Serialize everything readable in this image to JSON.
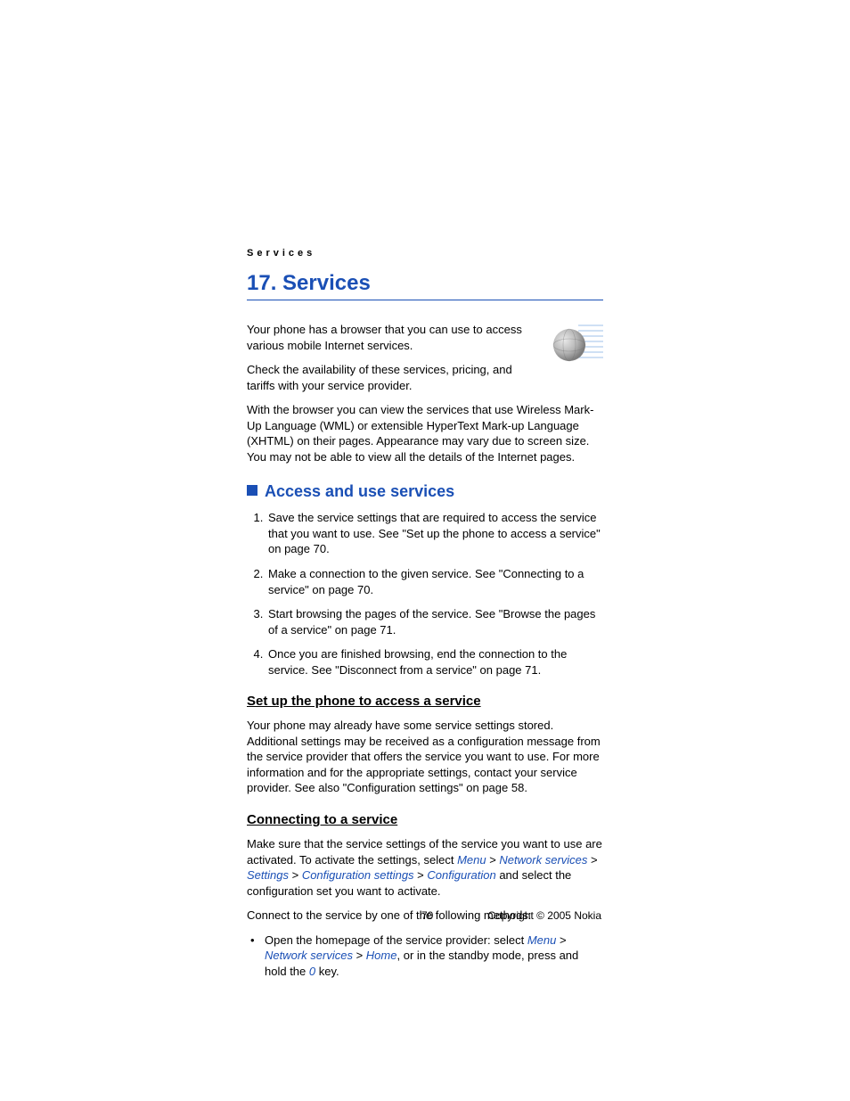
{
  "running_header": "Services",
  "chapter": {
    "number": "17.",
    "title": "Services"
  },
  "intro1": "Your phone has a browser that you can use to access various mobile Internet services.",
  "intro2": "Check the availability of these services, pricing, and tariffs with your service provider.",
  "intro3": "With the browser you can view the services that use Wireless Mark-Up Language (WML) or extensible HyperText Mark-up Language (XHTML) on their pages. Appearance may vary due to screen size. You may not be able to view all the details of the Internet pages.",
  "section1": {
    "title": "Access and use services",
    "items": [
      "Save the service settings that are required to access the service that you want to use. See \"Set up the phone to access a service\" on page 70.",
      "Make a connection to the given service. See \"Connecting to a service\" on page 70.",
      "Start browsing the pages of the service. See \"Browse the pages of a service\" on page 71.",
      "Once you are finished browsing, end the connection to the service. See \"Disconnect from a service\" on page 71."
    ]
  },
  "sub1": {
    "title": "Set up the phone to access a service",
    "body": "Your phone may already have some service settings stored. Additional settings may be received as a configuration message from the service provider that offers the service you want to use. For more information and for the appropriate settings, contact your service provider. See also \"Configuration settings\" on page 58."
  },
  "sub2": {
    "title": "Connecting to a service",
    "lead_prefix": "Make sure that the service settings of the service you want to use are activated. To activate the settings, select ",
    "path": {
      "menu": "Menu",
      "netserv": "Network services",
      "settings": "Settings",
      "confset": "Configuration settings",
      "conf": "Configuration"
    },
    "lead_suffix": " and select the configuration set you want to activate.",
    "methods_intro": "Connect to the service by one of the following methods:",
    "bullet1_prefix": "Open the homepage of the service provider: select ",
    "home": "Home",
    "bullet1_mid": ", or in the standby mode, press and hold the ",
    "zero": "0",
    "bullet1_end": " key."
  },
  "footer": {
    "page": "70",
    "copyright": "Copyright © 2005 Nokia"
  }
}
